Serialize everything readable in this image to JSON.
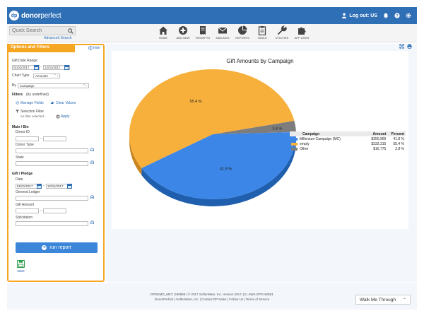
{
  "header": {
    "logo_mark": "dp",
    "logo_word1": "donor",
    "logo_word2": "perfect",
    "logout_label": "Log out: US"
  },
  "search": {
    "placeholder": "Quick Search",
    "advanced_label": "Advanced Search"
  },
  "nav": {
    "items": [
      {
        "label": "HOME",
        "icon": "home-icon"
      },
      {
        "label": "ADD NEW",
        "icon": "plus-circle-icon"
      },
      {
        "label": "RECEIPTS",
        "icon": "receipt-icon"
      },
      {
        "label": "MAILINGS",
        "icon": "envelope-icon"
      },
      {
        "label": "REPORTS",
        "icon": "pie-chart-icon"
      },
      {
        "label": "TASKS",
        "icon": "clipboard-icon"
      },
      {
        "label": "UTILITIES",
        "icon": "wrench-icon"
      },
      {
        "label": "APP LINKS",
        "icon": "puzzle-icon"
      }
    ]
  },
  "panel": {
    "tab_label": "Options and Filters",
    "hide_label": "hide",
    "gift_date_range_label": "Gift Date Range",
    "date_from": "01/01/2017",
    "date_to": "12/31/2017",
    "chart_type_label": "Chart Type",
    "chart_type_value": "Amounts",
    "by_label": "By",
    "by_value": "Campaign",
    "filters_label": "Filters",
    "filters_note": "(by undefined)",
    "manage_fields": "Manage Fields",
    "clear_values": "Clear Values",
    "selection_filter_label": "Selection Filter",
    "selection_filter_value": "no filter selected...",
    "apply_label": "Apply",
    "main_bio_label": "Main / Bio",
    "donor_id_label": "Donor ID",
    "range_dash": "-",
    "donor_type_label": "Donor Type",
    "state_label": "State",
    "gift_pledge_label": "Gift / Pledge",
    "date_label": "Date",
    "gp_date_from": "01/01/2017",
    "gp_date_to": "12/31/2017",
    "general_ledger_label": "General Ledger",
    "gift_amount_label": "Gift Amount",
    "solicitation_label": "Solicitation",
    "run_report_label": "run report",
    "save_label": "save"
  },
  "chart_data": {
    "type": "pie",
    "title": "Gift Amounts by Campaign",
    "legend_headers": [
      "Campaign",
      "Amount",
      "Percent"
    ],
    "categories": [
      "Millenium Campaign (MC)",
      "empty",
      "Other"
    ],
    "values": [
      250900,
      332315,
      16775
    ],
    "amount_labels": [
      "$250,900",
      "$332,315",
      "$16,775"
    ],
    "percent_labels": [
      "41.8 %",
      "55.4 %",
      "2.8 %"
    ],
    "slice_labels": [
      "41.8 %",
      "55.4 %",
      "2.8 %"
    ],
    "colors": [
      "#3b86e6",
      "#f7b03c",
      "#7d7d7d"
    ],
    "legend_position": "right"
  },
  "footer": {
    "line1": "DPDEMO_MKT, E99999 | © 2017 SofterWare, Inc. Version 2017.13 | AWS-DPO-WEB1",
    "line2": "DonorPerfect | SofterWare, Inc. | Contact DP Sales | Follow Us | Terms of Service"
  },
  "walk_me": {
    "label": "Walk Me Through"
  }
}
